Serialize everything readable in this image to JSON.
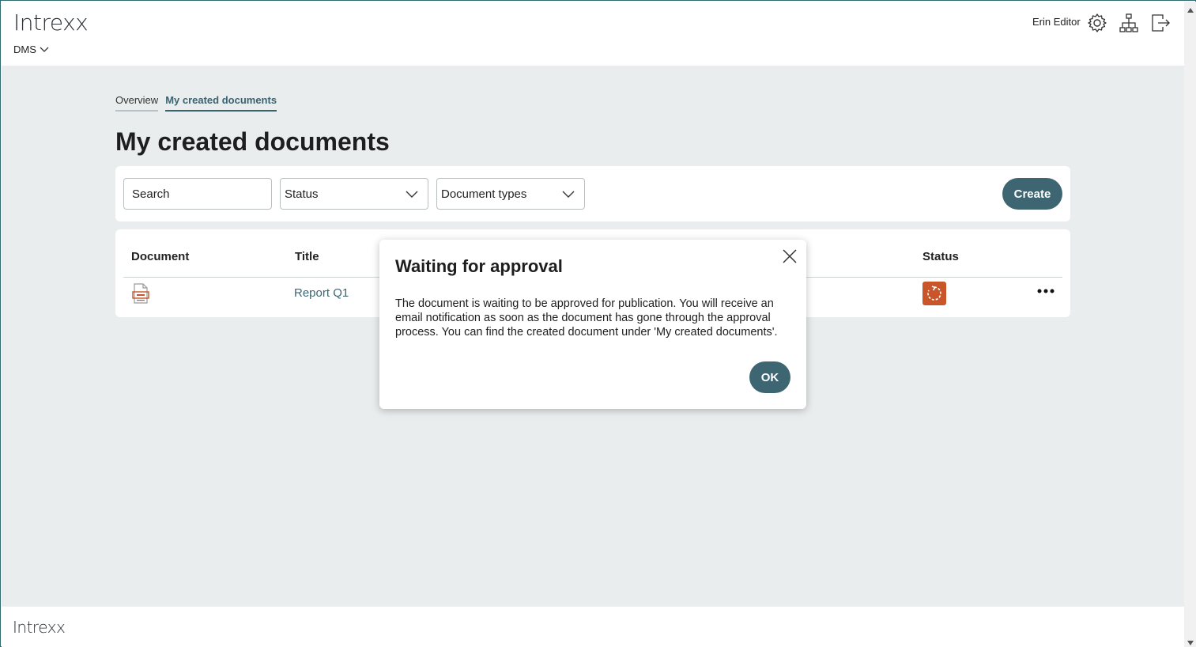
{
  "header": {
    "logo": "Intrexx",
    "app_switch_label": "DMS",
    "user_name": "Erin Editor",
    "icons": [
      "gear-icon",
      "sitemap-icon",
      "logout-icon"
    ]
  },
  "tabs": [
    {
      "label": "Overview",
      "active": false
    },
    {
      "label": "My created documents",
      "active": true
    }
  ],
  "page_title": "My created documents",
  "filters": {
    "search_placeholder": "Search",
    "status_label": "Status",
    "doc_types_label": "Document types",
    "create_label": "Create"
  },
  "table": {
    "headers": {
      "document": "Document",
      "title": "Title",
      "status": "Status"
    },
    "rows": [
      {
        "document_icon": "pdf-document-icon",
        "title": "Report Q1",
        "status_icon": "pending-approval-icon"
      }
    ]
  },
  "dialog": {
    "title": "Waiting for approval",
    "body": "The document is waiting to be approved for publication. You will receive an email notification as soon as the document has gone through the approval process. You can find the created document under 'My created documents'.",
    "ok_label": "OK"
  },
  "footer": {
    "logo": "Intrexx"
  },
  "colors": {
    "accent": "#3d6672",
    "status_pending": "#c8562a",
    "background": "#e9eded"
  }
}
